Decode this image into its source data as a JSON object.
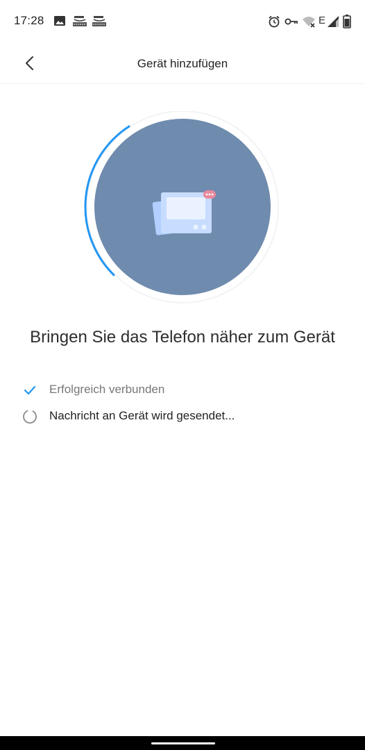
{
  "status_bar": {
    "time": "17:28",
    "left_icons": [
      "image-icon",
      "amazon-notification-icon",
      "amazon-notification-icon"
    ],
    "right_icons": [
      "alarm-icon",
      "vpn-key-icon",
      "wifi-off-icon",
      "network-e-icon",
      "cell-signal-icon",
      "battery-icon"
    ],
    "network_label": "E"
  },
  "header": {
    "title": "Gerät hinzufügen",
    "back_icon": "chevron-left-icon"
  },
  "illustration": {
    "circle_color": "#6f8bae",
    "progress_color": "#2196f3",
    "device_icon": "device-card-icon"
  },
  "instruction": "Bringen Sie das Telefon näher zum Gerät",
  "steps": [
    {
      "label": "Erfolgreich verbunden",
      "state": "done",
      "icon": "check-icon"
    },
    {
      "label": "Nachricht an Gerät wird gesendet...",
      "state": "in-progress",
      "icon": "spinner-icon"
    }
  ],
  "colors": {
    "accent": "#2196f3",
    "muted_text": "#777777"
  }
}
